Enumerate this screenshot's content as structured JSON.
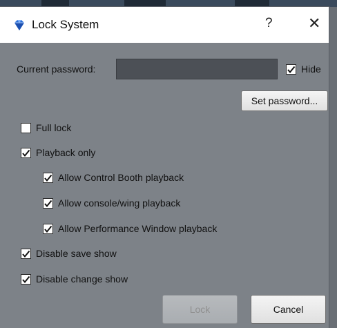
{
  "titlebar": {
    "title": "Lock System",
    "help_glyph": "?",
    "close_glyph": "✕",
    "app_icon": "diamond-icon",
    "app_icon_color": "#2b6fd6"
  },
  "password": {
    "label": "Current password:",
    "value": "",
    "hide_label": "Hide",
    "hide_checked": true
  },
  "buttons": {
    "set_password": "Set password...",
    "lock": "Lock",
    "cancel": "Cancel"
  },
  "options": {
    "full_lock": {
      "label": "Full lock",
      "checked": false
    },
    "playback_only": {
      "label": "Playback only",
      "checked": true
    },
    "allow_control_booth": {
      "label": "Allow Control Booth playback",
      "checked": true
    },
    "allow_console_wing": {
      "label": "Allow console/wing playback",
      "checked": true
    },
    "allow_performance_window": {
      "label": "Allow Performance Window playback",
      "checked": true
    },
    "disable_save_show": {
      "label": "Disable save show",
      "checked": true
    },
    "disable_change_show": {
      "label": "Disable change show",
      "checked": true
    }
  },
  "colors": {
    "dialog_bg": "#7d8288",
    "input_bg": "#4c5056"
  }
}
